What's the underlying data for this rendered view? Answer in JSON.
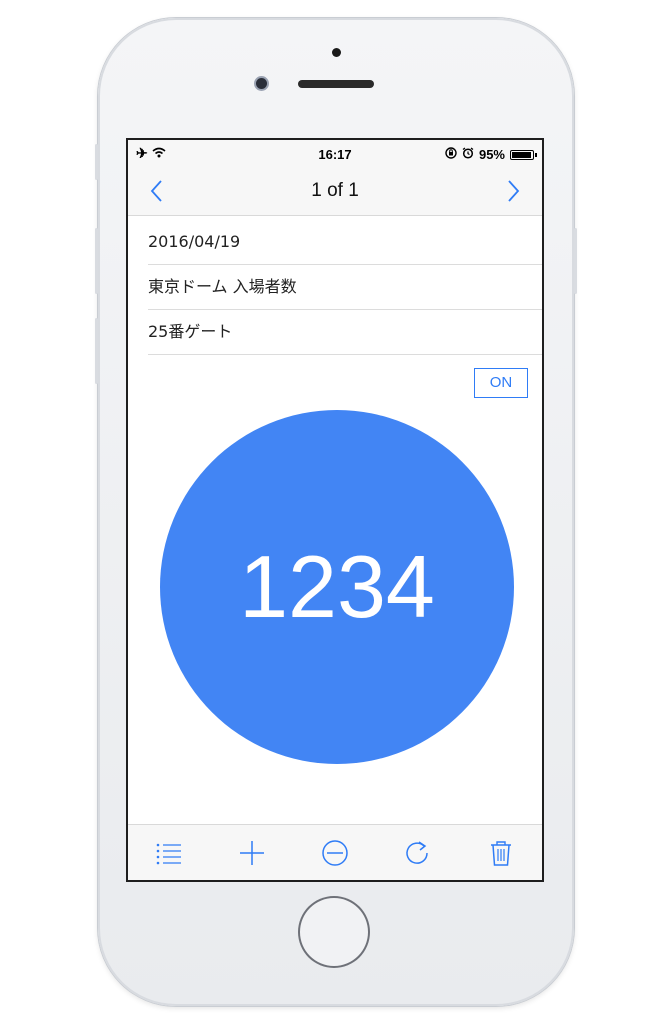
{
  "status_bar": {
    "time": "16:17",
    "battery": "95%",
    "left_icons": [
      "airplane-icon",
      "wifi-icon"
    ],
    "right_icons": [
      "rotation-lock-icon",
      "alarm-icon",
      "battery-icon"
    ]
  },
  "nav": {
    "title": "1 of 1",
    "left_icon": "chevron-left-icon",
    "right_icon": "chevron-right-icon"
  },
  "fields": {
    "date": "2016/04/19",
    "title": "東京ドーム 入場者数",
    "location": "25番ゲート"
  },
  "toggle": {
    "label": "ON"
  },
  "counter": {
    "value": "1234"
  },
  "toolbar": {
    "icons": [
      "list-icon",
      "plus-icon",
      "minus-circle-icon",
      "refresh-icon",
      "trash-icon"
    ]
  },
  "colors": {
    "accent": "#2f7cf6",
    "counter_bg": "#4285f4"
  }
}
